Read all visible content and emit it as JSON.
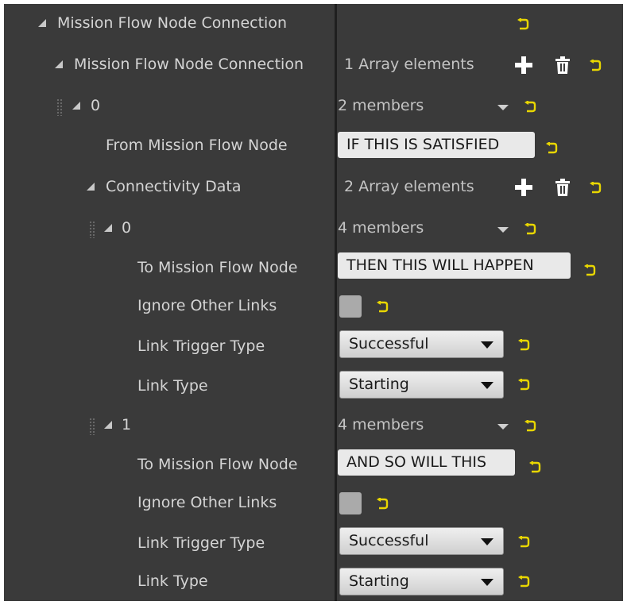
{
  "rows": {
    "root": {
      "label": "Mission Flow Node Connection"
    },
    "array": {
      "label": "Mission Flow Node Connection",
      "count": "1 Array elements"
    },
    "item0": {
      "label": "0",
      "members": "2 members"
    },
    "from_node": {
      "label": "From Mission Flow Node",
      "value": "IF THIS IS SATISFIED"
    },
    "connectivity": {
      "label": "Connectivity Data",
      "count": "2 Array elements"
    },
    "c0": {
      "index": {
        "label": "0",
        "members": "4 members"
      },
      "to_node": {
        "label": "To Mission Flow Node",
        "value": "THEN THIS WILL HAPPEN"
      },
      "ignore": {
        "label": "Ignore Other Links",
        "checked": false
      },
      "trigger": {
        "label": "Link Trigger Type",
        "value": "Successful"
      },
      "type": {
        "label": "Link Type",
        "value": "Starting"
      }
    },
    "c1": {
      "index": {
        "label": "1",
        "members": "4 members"
      },
      "to_node": {
        "label": "To Mission Flow Node",
        "value": "AND SO WILL THIS"
      },
      "ignore": {
        "label": "Ignore Other Links",
        "checked": false
      },
      "trigger": {
        "label": "Link Trigger Type",
        "value": "Successful"
      },
      "type": {
        "label": "Link Type",
        "value": "Starting"
      }
    }
  },
  "colors": {
    "panel_bg": "#3a3a3a",
    "divider": "#1f1f1f",
    "reset_arrow": "#e8d600",
    "text": "#d4d4d4"
  },
  "icons": [
    "expand-triangle-icon",
    "drag-grip-icon",
    "reset-to-default-icon",
    "add-element-icon",
    "trash-icon",
    "dropdown-chevron-icon"
  ]
}
